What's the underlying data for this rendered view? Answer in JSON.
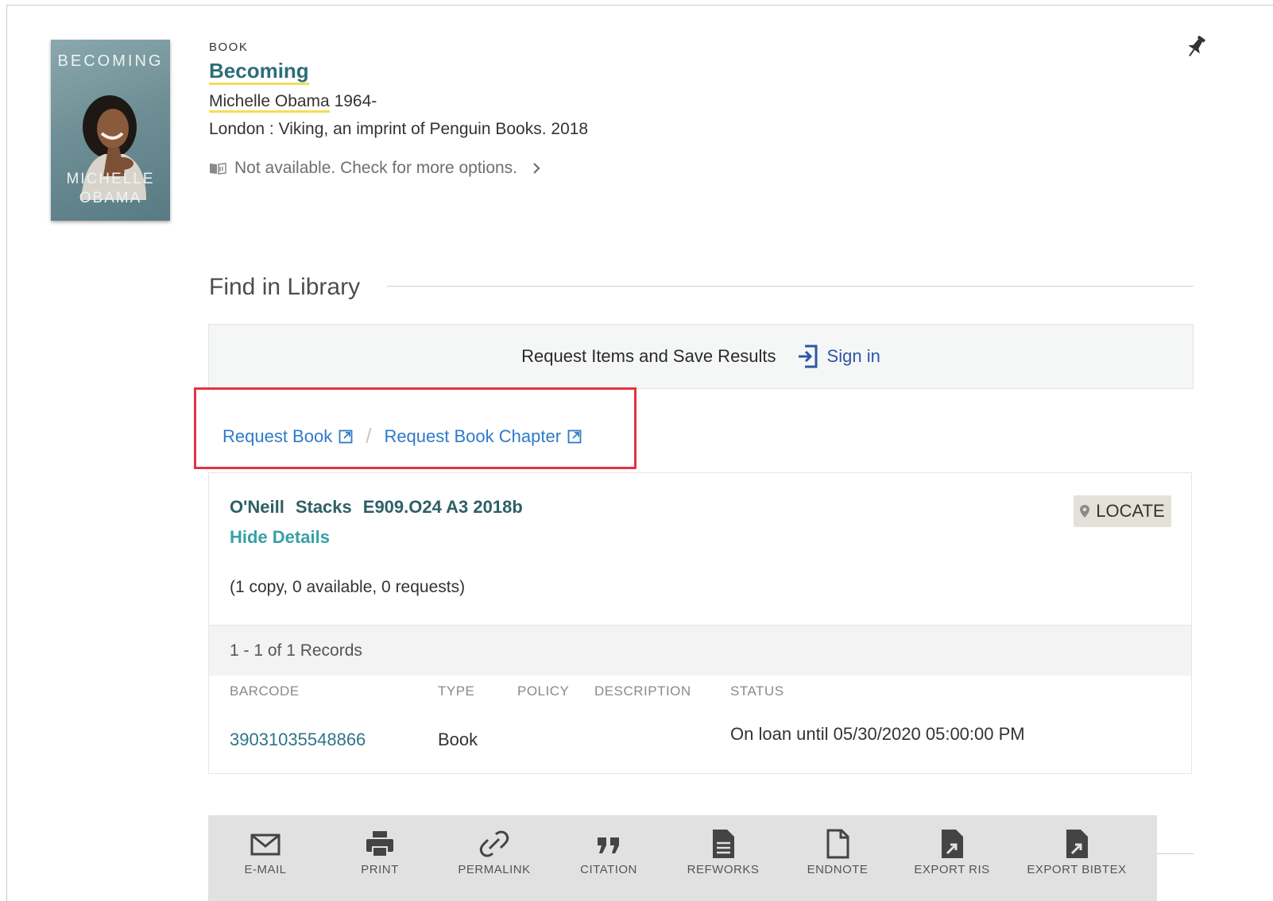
{
  "cover": {
    "title": "BECOMING",
    "author_line1": "MICHELLE",
    "author_line2": "OBAMA"
  },
  "record": {
    "type": "BOOK",
    "title": "Becoming",
    "author_name": "Michelle Obama",
    "author_dates": "1964-",
    "publication": "London : Viking, an imprint of Penguin Books. 2018",
    "availability": "Not available. Check for more options."
  },
  "find_in_library": {
    "heading": "Find in Library",
    "signin_prompt": "Request Items and Save Results",
    "signin_label": "Sign in",
    "request_book": "Request Book",
    "request_chapter": "Request Book Chapter",
    "request_box_color": "#e33340"
  },
  "holding": {
    "library": "O'Neill",
    "location": "Stacks",
    "call_number": "E909.O24 A3 2018b",
    "hide_details": "Hide Details",
    "locate_label": "LOCATE",
    "copies_summary": "(1 copy, 0 available, 0 requests)",
    "records_summary": "1 - 1 of 1 Records",
    "columns": [
      "BARCODE",
      "TYPE",
      "POLICY",
      "DESCRIPTION",
      "STATUS"
    ],
    "rows": [
      {
        "barcode": "39031035548866",
        "type": "Book",
        "policy": "",
        "description": "",
        "status": "On loan until 05/30/2020 05:00:00 PM"
      }
    ]
  },
  "actions": [
    {
      "label": "E-MAIL",
      "icon": "envelope-icon"
    },
    {
      "label": "PRINT",
      "icon": "printer-icon"
    },
    {
      "label": "PERMALINK",
      "icon": "link-icon"
    },
    {
      "label": "CITATION",
      "icon": "quote-icon"
    },
    {
      "label": "REFWORKS",
      "icon": "document-lines-icon"
    },
    {
      "label": "ENDNOTE",
      "icon": "document-icon"
    },
    {
      "label": "EXPORT RIS",
      "icon": "export-file-icon"
    },
    {
      "label": "EXPORT BIBTEX",
      "icon": "export-file-icon"
    }
  ],
  "colors": {
    "title": "#2c6e78",
    "highlight": "#f3dc5a",
    "link": "#2e7ac8",
    "signin": "#2e56a8"
  }
}
